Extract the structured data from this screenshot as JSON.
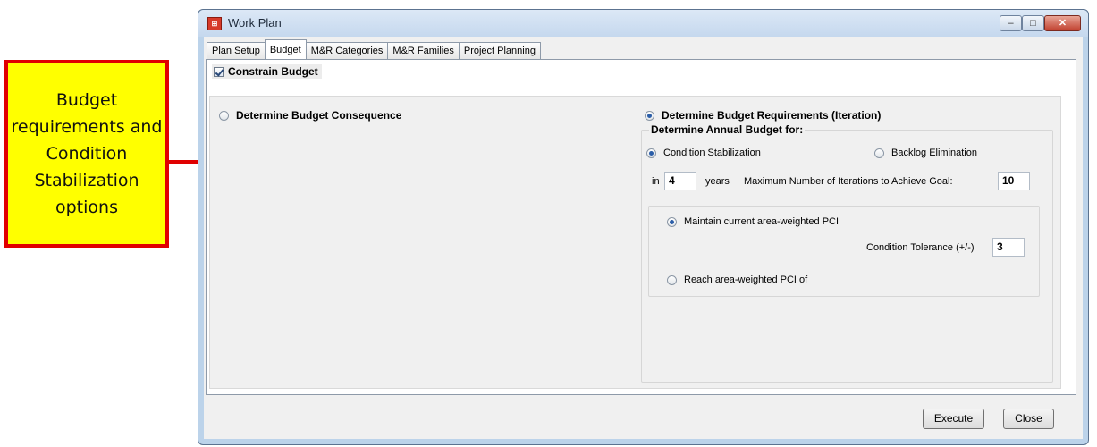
{
  "callout": {
    "text": "Budget requirements and Condition Stabilization options"
  },
  "window": {
    "title": "Work Plan",
    "app_icon_glyph": "⊞",
    "minimize_glyph": "–",
    "maximize_glyph": "□",
    "close_glyph": "✕"
  },
  "tabs": [
    {
      "label": "Plan Setup"
    },
    {
      "label": "Budget"
    },
    {
      "label": "M&R Categories"
    },
    {
      "label": "M&R Families"
    },
    {
      "label": "Project Planning"
    }
  ],
  "budget": {
    "constrain_label": "Constrain Budget",
    "constrain_checked": true,
    "consequence_label": "Determine Budget Consequence",
    "requirements_label": "Determine Budget Requirements (Iteration)",
    "annual_group_label": "Determine Annual Budget for:",
    "condition_stabilization_label": "Condition Stabilization",
    "backlog_elimination_label": "Backlog Elimination",
    "in_label": "in",
    "years_value": "4",
    "years_label": "years",
    "max_iter_label": "Maximum Number of Iterations to Achieve Goal:",
    "max_iter_value": "10",
    "maintain_label": "Maintain current area-weighted PCI",
    "tolerance_label": "Condition Tolerance (+/-)",
    "tolerance_value": "3",
    "reach_label": "Reach area-weighted PCI of"
  },
  "buttons": {
    "execute": "Execute",
    "close": "Close"
  },
  "colors": {
    "callout_fill": "#ffff00",
    "callout_border": "#e00000",
    "arrow": "#e00000",
    "arrowhead_fill": "#ffff00"
  }
}
